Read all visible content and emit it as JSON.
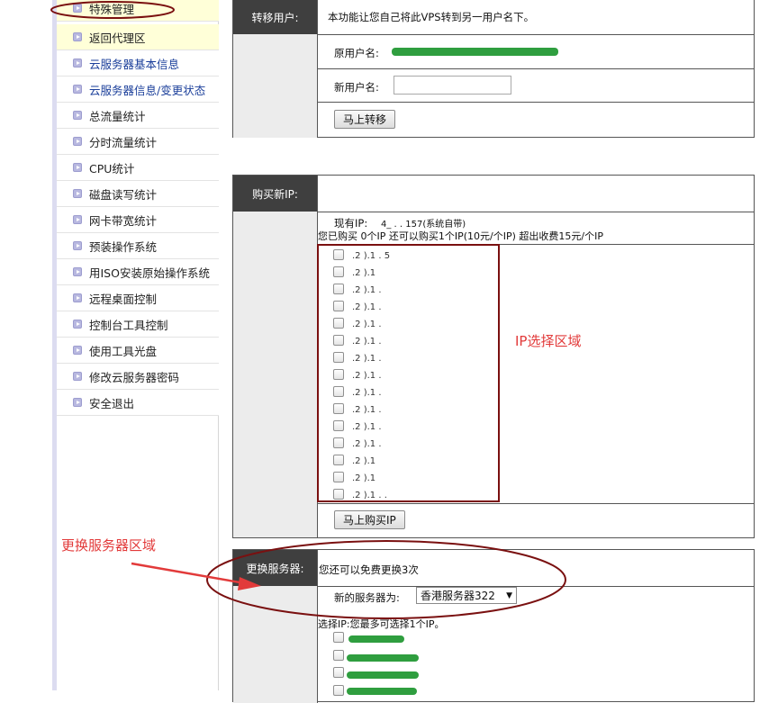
{
  "sidebar": {
    "items": [
      {
        "label": "特殊管理",
        "style": "sub yellow"
      },
      {
        "label": "返回代理区",
        "style": "sub yellow"
      },
      {
        "label": "云服务器基本信息",
        "style": "sub"
      },
      {
        "label": "云服务器信息/变更状态",
        "style": "sub"
      },
      {
        "label": "总流量统计",
        "style": ""
      },
      {
        "label": "分时流量统计",
        "style": ""
      },
      {
        "label": "CPU统计",
        "style": ""
      },
      {
        "label": "磁盘读写统计",
        "style": ""
      },
      {
        "label": "网卡带宽统计",
        "style": ""
      },
      {
        "label": "预装操作系统",
        "style": ""
      },
      {
        "label": "用ISO安装原始操作系统",
        "style": ""
      },
      {
        "label": "远程桌面控制",
        "style": ""
      },
      {
        "label": "控制台工具控制",
        "style": ""
      },
      {
        "label": "使用工具光盘",
        "style": ""
      },
      {
        "label": "修改云服务器密码",
        "style": ""
      },
      {
        "label": "安全退出",
        "style": ""
      }
    ]
  },
  "transfer": {
    "header": "转移用户:",
    "description": "本功能让您自己将此VPS转到另一用户名下。",
    "original_user_label": "原用户名:",
    "new_user_label": "新用户名:",
    "new_user_value": "",
    "submit_label": "马上转移"
  },
  "buy_ip": {
    "header": "购买新IP:",
    "current_ip_label": "现有IP:",
    "current_ip_value": "4_ . . 157(系统自带)",
    "purchased_info": "您已购买 0个IP 还可以购买1个IP(10元/个IP) 超出收费15元/个IP",
    "ip_options": [
      ".2 ).1 . 5",
      ".2 ).1",
      ".2 ).1 .",
      ".2 ).1 .",
      ".2 ).1 .",
      ".2 ).1 .",
      ".2 ).1 .",
      ".2 ).1 .",
      ".2 ).1 .",
      ".2 ).1 .",
      ".2 ).1 .",
      ".2 ).1 .",
      ".2 ).1",
      ".2 ).1",
      ".2 ).1 . ."
    ],
    "submit_label": "马上购买IP"
  },
  "change_server": {
    "header": "更换服务器:",
    "free_changes_text": "您还可以免费更换3次",
    "new_server_label": "新的服务器为:",
    "selected_server": "香港服务器322",
    "select_ip_text": "选择IP:您最多可选择1个IP。"
  },
  "annotations": {
    "ip_area": "IP选择区域",
    "change_server_area": "更换服务器区域"
  },
  "colors": {
    "annotation_red": "#e23a3a",
    "highlight_box": "#7a1010",
    "header_bg": "#3f3f3f",
    "redaction_green": "#2f9e3f"
  }
}
